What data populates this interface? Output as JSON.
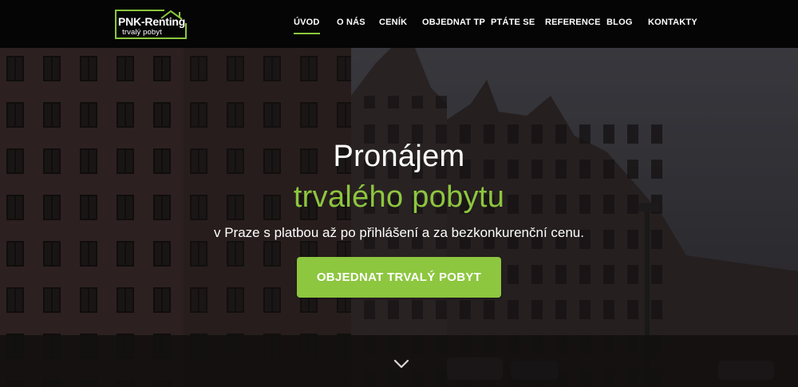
{
  "brand": {
    "name": "PNK-Renting",
    "tagline": "trvalý pobyt",
    "accent_color": "#8dc63f"
  },
  "nav": {
    "items": [
      {
        "label": "ÚVOD",
        "active": true
      },
      {
        "label": "O NÁS",
        "active": false
      },
      {
        "label": "CENÍK",
        "active": false
      },
      {
        "label": "OBJEDNAT TP",
        "active": false
      },
      {
        "label": "PTÁTE SE",
        "active": false
      },
      {
        "label": "REFERENCE",
        "active": false
      },
      {
        "label": "BLOG",
        "active": false
      },
      {
        "label": "KONTAKTY",
        "active": false
      }
    ]
  },
  "hero": {
    "title_line1": "Pronájem",
    "title_line2": "trvalého pobytu",
    "subtitle": "v Praze s platbou až po přihlášení a za bezkonkurenční cenu.",
    "cta_label": "OBJEDNAT TRVALÝ POBYT",
    "scroll_icon": "chevron-down-icon"
  }
}
